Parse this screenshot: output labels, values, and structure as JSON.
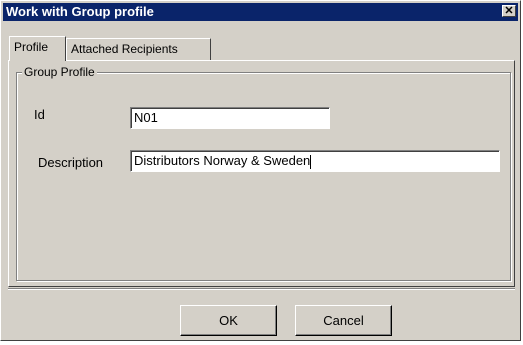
{
  "window": {
    "title": "Work with Group profile",
    "close_label": "✕"
  },
  "tabs": [
    {
      "label": "Profile",
      "active": true
    },
    {
      "label": "Attached Recipients",
      "active": false
    }
  ],
  "group": {
    "legend": "Group Profile",
    "id_label": "Id",
    "id_value": "N01",
    "description_label": "Description",
    "description_value": "Distributors Norway & Sweden"
  },
  "buttons": {
    "ok": "OK",
    "cancel": "Cancel"
  },
  "colors": {
    "titlebar": "#0a246a",
    "face": "#d4d0c8"
  }
}
